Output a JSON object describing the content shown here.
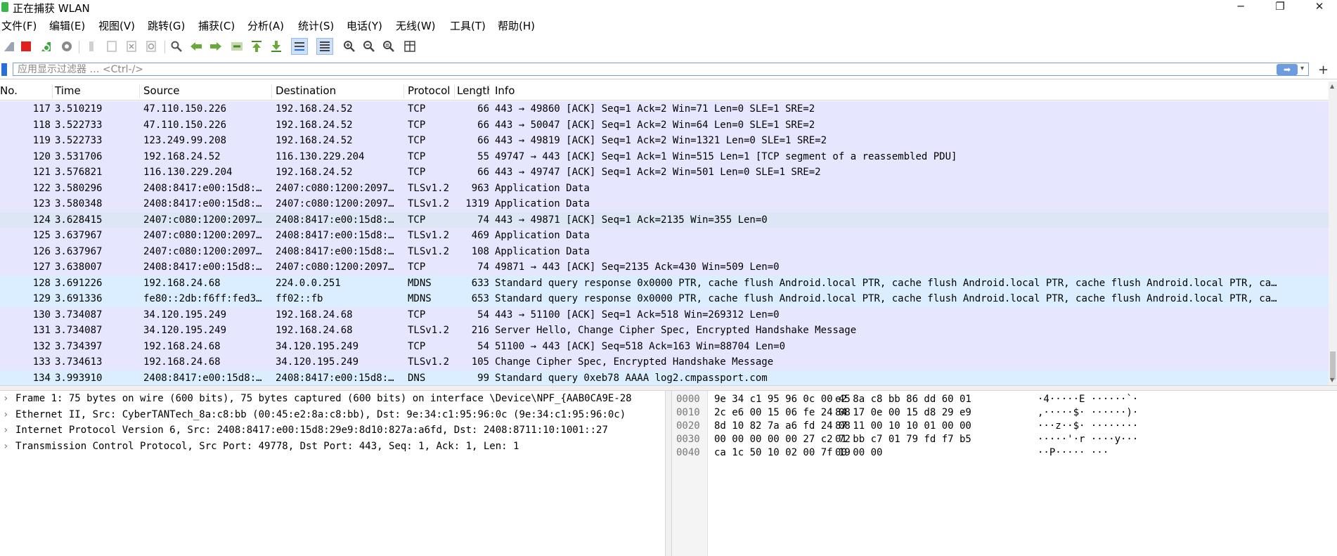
{
  "window": {
    "title": "正在捕获 WLAN",
    "minimize": "─",
    "maximize": "❐",
    "close": "✕"
  },
  "menu": [
    "文件(F)",
    "编辑(E)",
    "视图(V)",
    "跳转(G)",
    "捕获(C)",
    "分析(A)",
    "统计(S)",
    "电话(Y)",
    "无线(W)",
    "工具(T)",
    "帮助(H)"
  ],
  "filter": {
    "placeholder": "应用显示过滤器 … <Ctrl-/>",
    "value": "",
    "apply": "➡",
    "dropdown": "▾",
    "add": "+"
  },
  "columns": [
    "No.",
    "Time",
    "Source",
    "Destination",
    "Protocol",
    "Length",
    "Info"
  ],
  "packets": [
    {
      "no": "117",
      "time": "3.510219",
      "src": "47.110.150.226",
      "dst": "192.168.24.52",
      "proto": "TCP",
      "len": "66",
      "info": "443 → 49860 [ACK] Seq=1 Ack=2 Win=71 Len=0 SLE=1 SRE=2",
      "style": "tcp"
    },
    {
      "no": "118",
      "time": "3.522733",
      "src": "47.110.150.226",
      "dst": "192.168.24.52",
      "proto": "TCP",
      "len": "66",
      "info": "443 → 50047 [ACK] Seq=1 Ack=2 Win=64 Len=0 SLE=1 SRE=2",
      "style": "tcp"
    },
    {
      "no": "119",
      "time": "3.522733",
      "src": "123.249.99.208",
      "dst": "192.168.24.52",
      "proto": "TCP",
      "len": "66",
      "info": "443 → 49819 [ACK] Seq=1 Ack=2 Win=1321 Len=0 SLE=1 SRE=2",
      "style": "tcp"
    },
    {
      "no": "120",
      "time": "3.531706",
      "src": "192.168.24.52",
      "dst": "116.130.229.204",
      "proto": "TCP",
      "len": "55",
      "info": "49747 → 443 [ACK] Seq=1 Ack=1 Win=515 Len=1 [TCP segment of a reassembled PDU]",
      "style": "tcp"
    },
    {
      "no": "121",
      "time": "3.576821",
      "src": "116.130.229.204",
      "dst": "192.168.24.52",
      "proto": "TCP",
      "len": "66",
      "info": "443 → 49747 [ACK] Seq=1 Ack=2 Win=501 Len=0 SLE=1 SRE=2",
      "style": "tcp"
    },
    {
      "no": "122",
      "time": "3.580296",
      "src": "2408:8417:e00:15d8:…",
      "dst": "2407:c080:1200:2097…",
      "proto": "TLSv1.2",
      "len": "963",
      "info": "Application Data",
      "style": "tcp"
    },
    {
      "no": "123",
      "time": "3.580348",
      "src": "2408:8417:e00:15d8:…",
      "dst": "2407:c080:1200:2097…",
      "proto": "TLSv1.2",
      "len": "1319",
      "info": "Application Data",
      "style": "tcp"
    },
    {
      "no": "124",
      "time": "3.628415",
      "src": "2407:c080:1200:2097…",
      "dst": "2408:8417:e00:15d8:…",
      "proto": "TCP",
      "len": "74",
      "info": "443 → 49871 [ACK] Seq=1 Ack=2135 Win=355 Len=0",
      "style": "sel"
    },
    {
      "no": "125",
      "time": "3.637967",
      "src": "2407:c080:1200:2097…",
      "dst": "2408:8417:e00:15d8:…",
      "proto": "TLSv1.2",
      "len": "469",
      "info": "Application Data",
      "style": "tcp"
    },
    {
      "no": "126",
      "time": "3.637967",
      "src": "2407:c080:1200:2097…",
      "dst": "2408:8417:e00:15d8:…",
      "proto": "TLSv1.2",
      "len": "108",
      "info": "Application Data",
      "style": "tcp"
    },
    {
      "no": "127",
      "time": "3.638007",
      "src": "2408:8417:e00:15d8:…",
      "dst": "2407:c080:1200:2097…",
      "proto": "TCP",
      "len": "74",
      "info": "49871 → 443 [ACK] Seq=2135 Ack=430 Win=509 Len=0",
      "style": "tcp"
    },
    {
      "no": "128",
      "time": "3.691226",
      "src": "192.168.24.68",
      "dst": "224.0.0.251",
      "proto": "MDNS",
      "len": "633",
      "info": "Standard query response 0x0000 PTR, cache flush Android.local PTR, cache flush Android.local PTR, cache flush Android.local PTR, ca…",
      "style": "udp"
    },
    {
      "no": "129",
      "time": "3.691336",
      "src": "fe80::2db:f6ff:fed3…",
      "dst": "ff02::fb",
      "proto": "MDNS",
      "len": "653",
      "info": "Standard query response 0x0000 PTR, cache flush Android.local PTR, cache flush Android.local PTR, cache flush Android.local PTR, ca…",
      "style": "udp"
    },
    {
      "no": "130",
      "time": "3.734087",
      "src": "34.120.195.249",
      "dst": "192.168.24.68",
      "proto": "TCP",
      "len": "54",
      "info": "443 → 51100 [ACK] Seq=1 Ack=518 Win=269312 Len=0",
      "style": "tcp"
    },
    {
      "no": "131",
      "time": "3.734087",
      "src": "34.120.195.249",
      "dst": "192.168.24.68",
      "proto": "TLSv1.2",
      "len": "216",
      "info": "Server Hello, Change Cipher Spec, Encrypted Handshake Message",
      "style": "tcp"
    },
    {
      "no": "132",
      "time": "3.734397",
      "src": "192.168.24.68",
      "dst": "34.120.195.249",
      "proto": "TCP",
      "len": "54",
      "info": "51100 → 443 [ACK] Seq=518 Ack=163 Win=88704 Len=0",
      "style": "tcp"
    },
    {
      "no": "133",
      "time": "3.734613",
      "src": "192.168.24.68",
      "dst": "34.120.195.249",
      "proto": "TLSv1.2",
      "len": "105",
      "info": "Change Cipher Spec, Encrypted Handshake Message",
      "style": "tcp"
    },
    {
      "no": "134",
      "time": "3.993910",
      "src": "2408:8417:e00:15d8:…",
      "dst": "2408:8417:e00:15d8:…",
      "proto": "DNS",
      "len": "99",
      "info": "Standard query 0xeb78 AAAA log2.cmpassport.com",
      "style": "udp"
    }
  ],
  "details": [
    "Frame 1: 75 bytes on wire (600 bits), 75 bytes captured (600 bits) on interface \\Device\\NPF_{AAB0CA9E-28",
    "Ethernet II, Src: CyberTANTech_8a:c8:bb (00:45:e2:8a:c8:bb), Dst: 9e:34:c1:95:96:0c (9e:34:c1:95:96:0c)",
    "Internet Protocol Version 6, Src: 2408:8417:e00:15d8:29e9:8d10:827a:a6fd, Dst: 2408:8711:10:1001::27",
    "Transmission Control Protocol, Src Port: 49778, Dst Port: 443, Seq: 1, Ack: 1, Len: 1"
  ],
  "detail_expander": "›",
  "hex": [
    {
      "off": "0000",
      "b1": "9e 34 c1 95 96 0c 00 45",
      "b2": "e2 8a c8 bb 86 dd 60 01",
      "asc": "·4·····E ······`·"
    },
    {
      "off": "0010",
      "b1": "2c e6 00 15 06 fe 24 08",
      "b2": "84 17 0e 00 15 d8 29 e9",
      "asc": ",·····$· ······)·"
    },
    {
      "off": "0020",
      "b1": "8d 10 82 7a a6 fd 24 08",
      "b2": "87 11 00 10 10 01 00 00",
      "asc": "···z··$· ········"
    },
    {
      "off": "0030",
      "b1": "00 00 00 00 00 27 c2 72",
      "b2": "01 bb c7 01 79 fd f7 b5",
      "asc": "·····'·r ····y···"
    },
    {
      "off": "0040",
      "b1": "ca 1c 50 10 02 00 7f 19",
      "b2": "00 00 00",
      "asc": "··P····· ···"
    }
  ],
  "colors": {
    "tcp_row": "#e7e6ff",
    "udp_row": "#daeeff",
    "selected_row": "#dce6f4",
    "stop_button": "#e0201c",
    "restart_button": "#3aa83a"
  }
}
